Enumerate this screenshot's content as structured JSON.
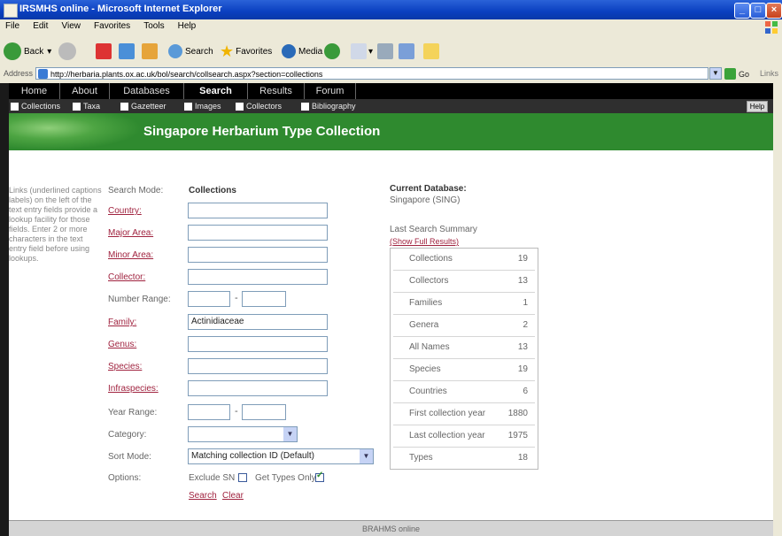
{
  "window": {
    "title": "IRSMHS online - Microsoft Internet Explorer"
  },
  "menubar": [
    "File",
    "Edit",
    "View",
    "Favorites",
    "Tools",
    "Help"
  ],
  "toolbar": {
    "back": "Back",
    "search": "Search",
    "favorites": "Favorites",
    "media": "Media"
  },
  "addressbar": {
    "label": "Address",
    "url": "http://herbaria.plants.ox.ac.uk/bol/search/collsearch.aspx?section=collections",
    "go": "Go",
    "links": "Links"
  },
  "nav": {
    "tabs": [
      "Home",
      "About",
      "Databases",
      "Search",
      "Results",
      "Forum"
    ],
    "active": "Search",
    "sub": [
      "Collections",
      "Taxa",
      "Gazetteer",
      "Images",
      "Collectors",
      "Bibliography"
    ],
    "help": "Help"
  },
  "banner": {
    "title": "Singapore Herbarium Type Collection"
  },
  "hint": "Links (underlined captions labels) on the left of the text entry fields provide a lookup facility for those fields. Enter 2 or more characters in the text entry field before using lookups.",
  "form": {
    "search_mode_label": "Search Mode:",
    "search_mode_value": "Collections",
    "country": "Country:",
    "major_area": "Major Area:",
    "minor_area": "Minor Area:",
    "collector": "Collector:",
    "number_range": "Number Range:",
    "family": "Family:",
    "family_value": "Actinidiaceae",
    "genus": "Genus:",
    "species": "Species:",
    "infraspecies": "Infraspecies:",
    "year_range": "Year Range:",
    "category": "Category:",
    "sort_mode": "Sort Mode:",
    "sort_value": "Matching collection ID (Default)",
    "options": "Options:",
    "exclude_sn": "Exclude SN",
    "get_types_only": "Get Types Only",
    "search_link": "Search",
    "clear_link": "Clear"
  },
  "summary": {
    "current_db_title": "Current Database:",
    "current_db": "Singapore (SING)",
    "last_title": "Last Search Summary",
    "show_link": "(Show Full Results)",
    "rows": [
      {
        "label": "Collections",
        "value": "19"
      },
      {
        "label": "Collectors",
        "value": "13"
      },
      {
        "label": "Families",
        "value": "1"
      },
      {
        "label": "Genera",
        "value": "2"
      },
      {
        "label": "All Names",
        "value": "13"
      },
      {
        "label": "Species",
        "value": "19"
      },
      {
        "label": "Countries",
        "value": "6"
      },
      {
        "label": "First collection year",
        "value": "1880"
      },
      {
        "label": "Last collection year",
        "value": "1975"
      },
      {
        "label": "Types",
        "value": "18"
      }
    ]
  },
  "footer": "BRAHMS online"
}
